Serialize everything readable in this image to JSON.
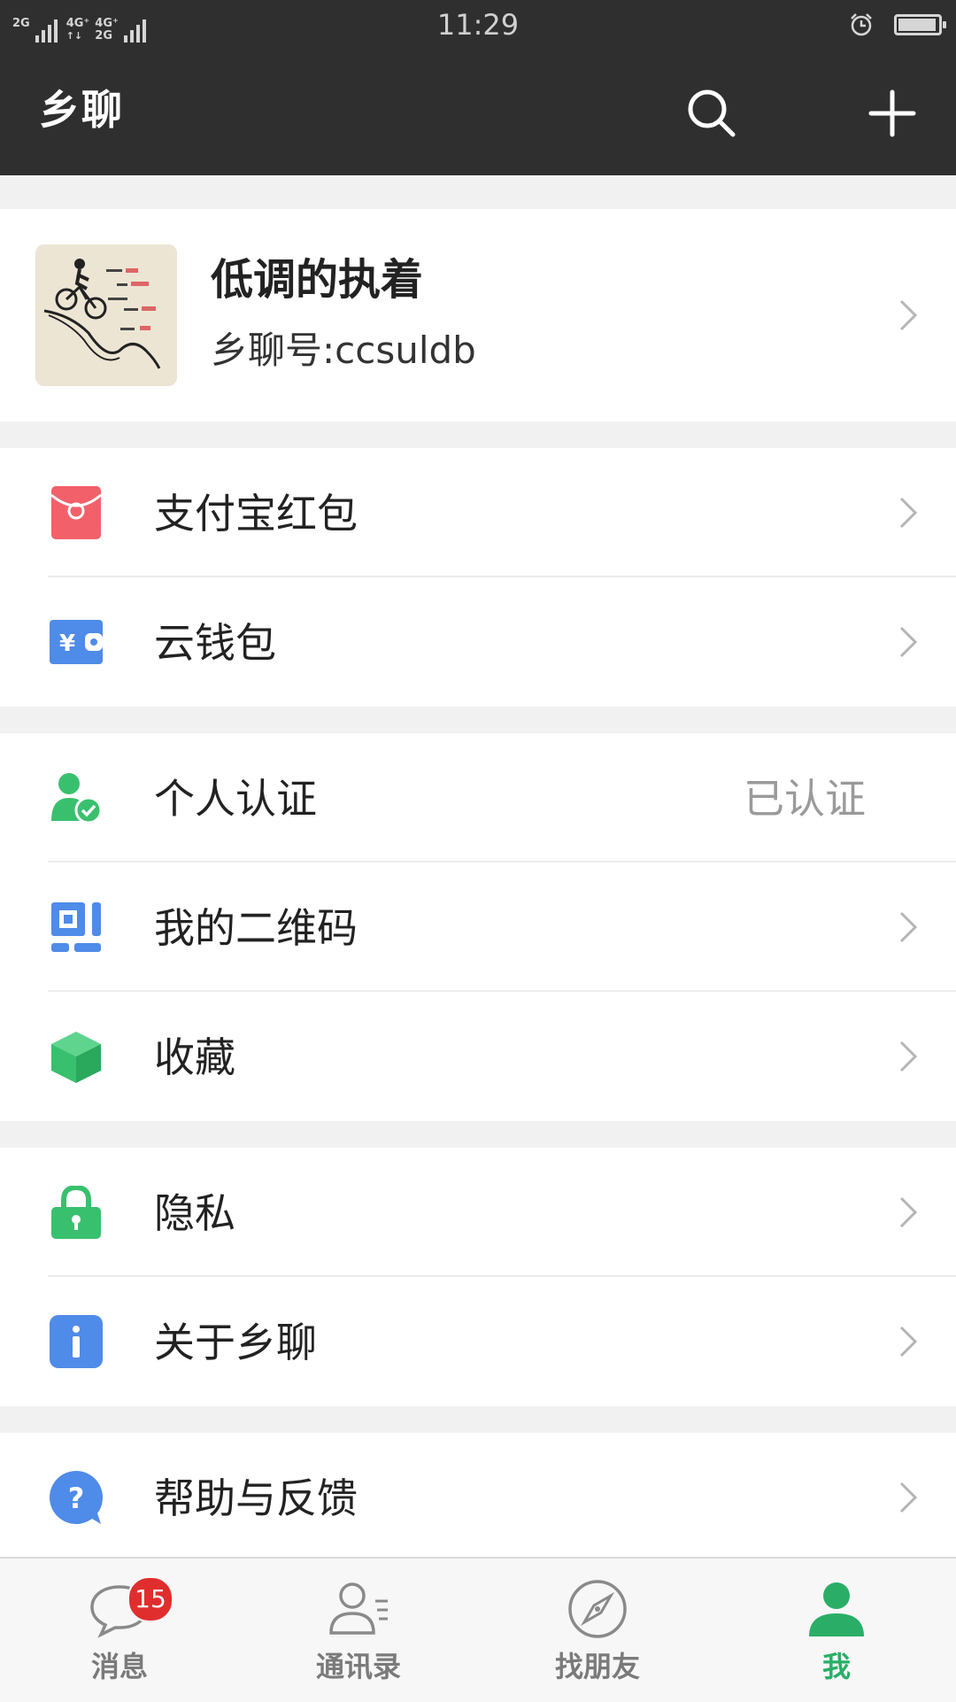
{
  "status_bar": {
    "sim1": "2G",
    "sim2_top": "4G⁺",
    "sim2_bottom": "4G⁺",
    "sim2_lower": "2G",
    "time": "11:29",
    "alarm_icon": "alarm-clock-icon",
    "battery_level": 0.95
  },
  "header": {
    "title": "乡聊",
    "search_icon": "search-icon",
    "add_icon": "plus-icon"
  },
  "profile": {
    "name": "低调的执着",
    "id_text": "乡聊号:ccsuldb"
  },
  "sections": [
    {
      "items": [
        {
          "label": "支付宝红包",
          "icon": "red-envelope-icon",
          "color": "#f2606a"
        },
        {
          "label": "云钱包",
          "icon": "wallet-icon",
          "color": "#4f8be8"
        }
      ]
    },
    {
      "items": [
        {
          "label": "个人认证",
          "value": "已认证",
          "icon": "verified-user-icon",
          "color": "#39c06e"
        },
        {
          "label": "我的二维码",
          "icon": "qr-code-icon",
          "color": "#4f8be8"
        },
        {
          "label": "收藏",
          "icon": "box-icon",
          "color": "#39c06e"
        }
      ]
    },
    {
      "items": [
        {
          "label": "隐私",
          "icon": "lock-icon",
          "color": "#39c06e"
        },
        {
          "label": "关于乡聊",
          "icon": "info-icon",
          "color": "#4f8be8"
        }
      ]
    },
    {
      "items": [
        {
          "label": "帮助与反馈",
          "icon": "help-icon",
          "color": "#4f8be8"
        }
      ]
    }
  ],
  "tabs": [
    {
      "label": "消息",
      "icon": "chat-bubble-icon",
      "badge": "15"
    },
    {
      "label": "通讯录",
      "icon": "contacts-icon"
    },
    {
      "label": "找朋友",
      "icon": "compass-icon"
    },
    {
      "label": "我",
      "icon": "person-icon",
      "active": true
    }
  ],
  "colors": {
    "header_bg": "#2f2f2f",
    "accent_green": "#2aae67",
    "badge_red": "#e02e2e"
  }
}
